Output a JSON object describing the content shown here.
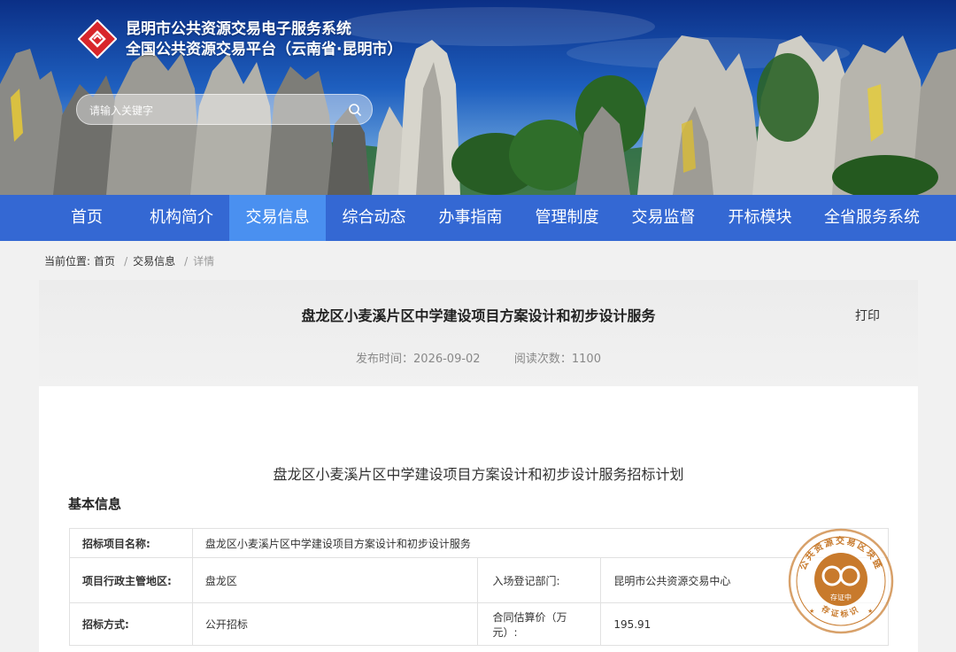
{
  "header": {
    "title_line1": "昆明市公共资源交易电子服务系统",
    "title_line2": "全国公共资源交易平台（云南省·昆明市）",
    "search": {
      "placeholder": "请输入关键字"
    }
  },
  "nav": {
    "items": [
      {
        "label": "首页"
      },
      {
        "label": "机构简介"
      },
      {
        "label": "交易信息"
      },
      {
        "label": "综合动态"
      },
      {
        "label": "办事指南"
      },
      {
        "label": "管理制度"
      },
      {
        "label": "交易监督"
      },
      {
        "label": "开标模块"
      },
      {
        "label": "全省服务系统"
      }
    ],
    "active_index": 2
  },
  "breadcrumb": {
    "prefix": "当前位置:",
    "items": [
      "首页",
      "交易信息"
    ],
    "current": "详情"
  },
  "article": {
    "title": "盘龙区小麦溪片区中学建设项目方案设计和初步设计服务",
    "print_label": "打印",
    "publish_label": "发布时间：",
    "publish_date": "2026-09-02",
    "views_label": "阅读次数：",
    "views": "1100",
    "doc_title": "盘龙区小麦溪片区中学建设项目方案设计和初步设计服务招标计划",
    "section_title": "基本信息",
    "table": {
      "r1": {
        "label": "招标项目名称:",
        "value": "盘龙区小麦溪片区中学建设项目方案设计和初步设计服务"
      },
      "r2": {
        "label": "项目行政主管地区:",
        "value": "盘龙区",
        "label2": "入场登记部门:",
        "value2": "昆明市公共资源交易中心"
      },
      "r3": {
        "label": "招标方式:",
        "value": "公开招标",
        "label2": "合同估算价（万元）:",
        "value2": "195.91"
      }
    }
  },
  "stamp": {
    "top_text": "公共资源交易区块链",
    "center_text": "存证中",
    "bottom_text": "存证标识"
  },
  "colors": {
    "nav_bg": "#3468d3",
    "nav_active": "#4a90f0",
    "stamp": "#c87a2c",
    "logo_red": "#d8262a"
  }
}
